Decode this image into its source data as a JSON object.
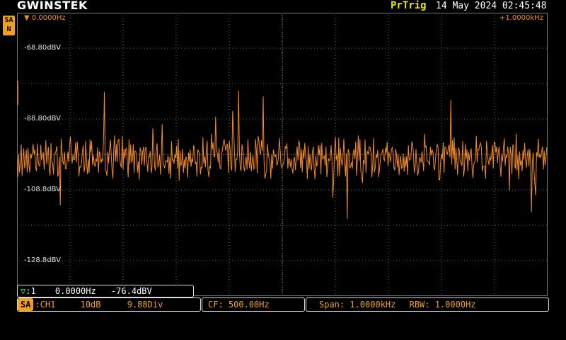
{
  "header": {
    "brand": "GWINSTEK",
    "trigger": "PrTrig",
    "datetime": "14 May 2024 02:45:48"
  },
  "side_badge": {
    "line1": "SA",
    "line2": "N"
  },
  "screen": {
    "start_freq": "0.0000Hz",
    "span_freq": "+1.0000kHz",
    "y_labels": [
      "-68.80dBV",
      "-88.80dBV",
      "-108.8dBV",
      "-128.8dBV"
    ]
  },
  "marker": {
    "icon": "triangle-down-icon",
    "index": ":1",
    "freq": "0.0000Hz",
    "level": "-76.4dBV"
  },
  "status": {
    "mode": "SA",
    "source": ":CH1",
    "scale": "10dB",
    "div": "9.88Div",
    "center": "CF: 500.00Hz",
    "span": "Span: 1.0000kHz",
    "rbw": "RBW: 1.0000Hz"
  },
  "colors": {
    "trace": "#f08a2a",
    "accent": "#f0a020",
    "trigger": "#e6e600"
  }
}
